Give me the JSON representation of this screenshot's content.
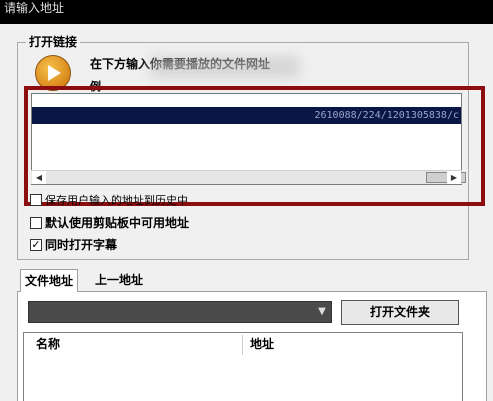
{
  "window": {
    "title": "请输入地址"
  },
  "open_link_group": {
    "title": "打开链接",
    "instruction": "在下方输入你需要播放的文件网址",
    "instruction_line2": "例",
    "url_value": "2610088/224/1201305838/c"
  },
  "options": {
    "save_history_label": "保存用户输入的地址到历史中",
    "use_clipboard_label": "默认使用剪贴板中可用地址",
    "open_subtitles_label": "同时打开字幕",
    "use_clipboard_checked": false,
    "open_subtitles_checked": true
  },
  "tabs": [
    {
      "label": "文件地址",
      "active": true
    },
    {
      "label": "上一地址",
      "active": false
    }
  ],
  "file_panel": {
    "open_folder_label": "打开文件夹",
    "columns": [
      "名称",
      "地址"
    ]
  },
  "icons": {
    "play": "play-icon",
    "dropdown": "chevron-down-icon",
    "scroll_left": "arrow-left-icon",
    "scroll_right": "arrow-right-icon"
  },
  "colors": {
    "highlight_border": "#8b0d0d",
    "selection_bg": "#0a1746",
    "play_icon": "#e09a26"
  }
}
